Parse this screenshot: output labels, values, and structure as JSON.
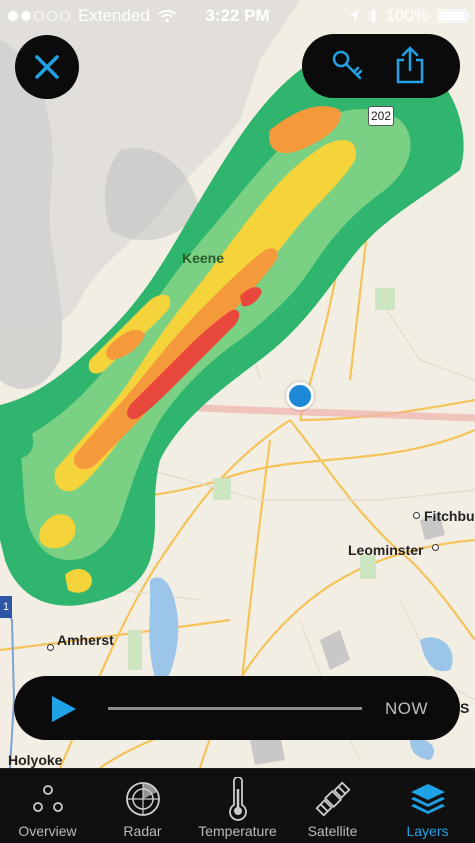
{
  "status_bar": {
    "carrier": "Extended",
    "time": "3:22 PM",
    "battery": "100%"
  },
  "map": {
    "cities": [
      "Keene",
      "Fitchbu",
      "Leominster",
      "Amherst",
      "Holyoke"
    ],
    "route_shield": "202",
    "interstate": "1",
    "partial_label": "S"
  },
  "player": {
    "now_label": "NOW"
  },
  "tabs": [
    {
      "label": "Overview",
      "icon": "overview-icon"
    },
    {
      "label": "Radar",
      "icon": "radar-icon"
    },
    {
      "label": "Temperature",
      "icon": "thermometer-icon"
    },
    {
      "label": "Satellite",
      "icon": "satellite-icon"
    },
    {
      "label": "Layers",
      "icon": "layers-icon",
      "active": true
    }
  ],
  "colors": {
    "accent": "#1fa3e6",
    "radar_green": "#2db86a",
    "radar_yellow": "#f5d33a",
    "radar_orange": "#f59a3a",
    "radar_red": "#e8473c"
  }
}
